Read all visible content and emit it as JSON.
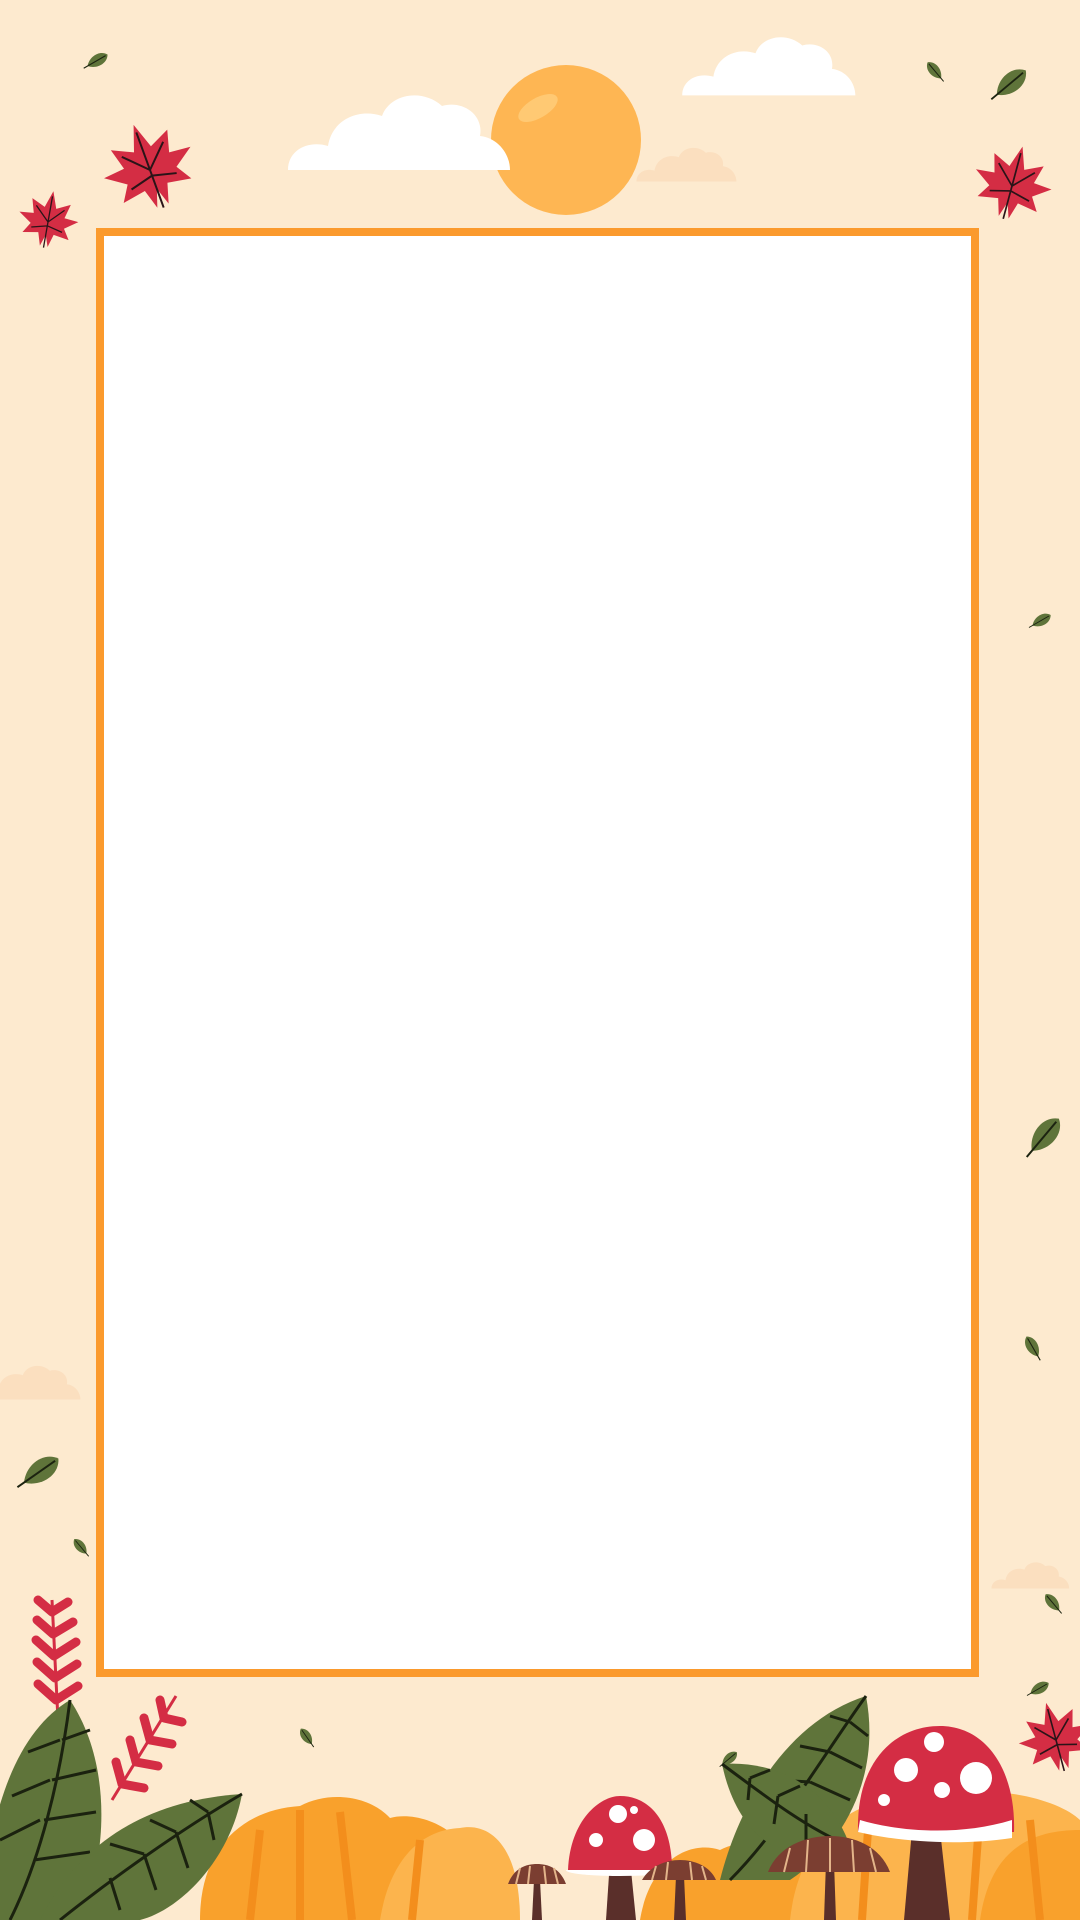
{
  "colors": {
    "background": "#fdeacf",
    "frame_border": "#fb9a2d",
    "frame_fill": "#ffffff",
    "sun": "#feb653",
    "cloud": "#ffffff",
    "faint_cloud": "#f9d5b2",
    "red_leaf": "#d42d44",
    "green_leaf": "#5f743a",
    "orange_bush": "#f9a12c",
    "light_bush": "#fcb44d",
    "mushroom_cap_red": "#d42d44",
    "mushroom_cap_brown": "#7b3e31",
    "mushroom_stem": "#5a2f2a"
  },
  "decorations": {
    "sun": "sun-icon",
    "clouds": "cloud-icon",
    "maple_leaves": "maple-leaf-icon",
    "green_leaves": "green-leaf-icon",
    "fern": "fern-icon",
    "mushrooms": "mushroom-icon",
    "bushes": "bush-icon"
  },
  "frame": {
    "content": ""
  }
}
